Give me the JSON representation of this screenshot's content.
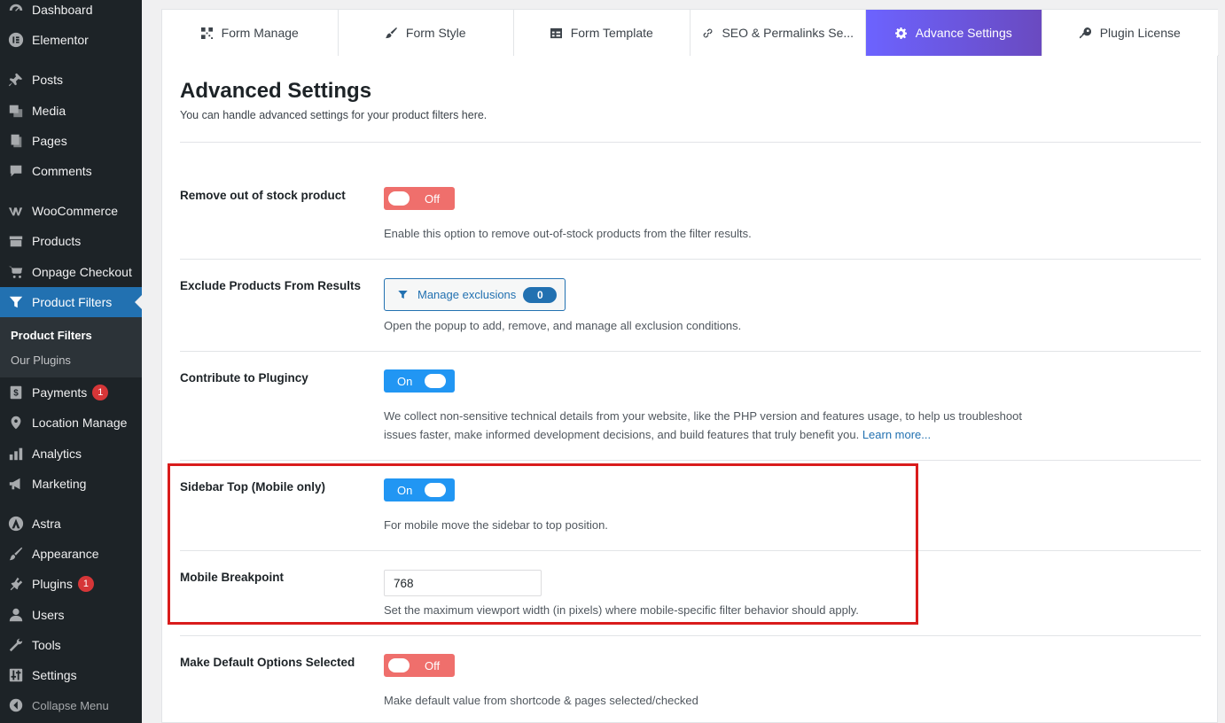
{
  "sidebar": {
    "items": [
      {
        "label": "Dashboard",
        "icon": "dashboard-icon"
      },
      {
        "label": "Elementor",
        "icon": "elementor-icon"
      },
      {
        "label": "Posts",
        "icon": "pin-icon"
      },
      {
        "label": "Media",
        "icon": "media-icon"
      },
      {
        "label": "Pages",
        "icon": "pages-icon"
      },
      {
        "label": "Comments",
        "icon": "comments-icon"
      },
      {
        "label": "WooCommerce",
        "icon": "woocommerce-icon"
      },
      {
        "label": "Products",
        "icon": "products-icon"
      },
      {
        "label": "Onpage Checkout",
        "icon": "cart-icon"
      },
      {
        "label": "Product Filters",
        "icon": "filter-icon"
      },
      {
        "label": "Payments",
        "icon": "payments-icon",
        "badge": "1"
      },
      {
        "label": "Location Manage",
        "icon": "location-icon"
      },
      {
        "label": "Analytics",
        "icon": "analytics-icon"
      },
      {
        "label": "Marketing",
        "icon": "megaphone-icon"
      },
      {
        "label": "Astra",
        "icon": "astra-icon"
      },
      {
        "label": "Appearance",
        "icon": "brush-icon"
      },
      {
        "label": "Plugins",
        "icon": "plugin-icon",
        "badge": "1"
      },
      {
        "label": "Users",
        "icon": "user-icon"
      },
      {
        "label": "Tools",
        "icon": "wrench-icon"
      },
      {
        "label": "Settings",
        "icon": "settings-sliders-icon"
      }
    ],
    "submenu": [
      "Product Filters",
      "Our Plugins"
    ],
    "collapse_label": "Collapse Menu"
  },
  "tabs": [
    {
      "label": "Form Manage",
      "icon": "qr-grid-icon"
    },
    {
      "label": "Form Style",
      "icon": "brush-icon"
    },
    {
      "label": "Form Template",
      "icon": "table-icon"
    },
    {
      "label": "SEO & Permalinks Se...",
      "icon": "link-icon"
    },
    {
      "label": "Advance Settings",
      "icon": "gear-icon"
    },
    {
      "label": "Plugin License",
      "icon": "key-icon"
    }
  ],
  "main": {
    "title": "Advanced Settings",
    "subtitle": "You can handle advanced settings for your product filters here."
  },
  "settings": {
    "remove_oos": {
      "label": "Remove out of stock product",
      "state": "Off",
      "desc": "Enable this option to remove out-of-stock products from the filter results."
    },
    "exclude": {
      "label": "Exclude Products From Results",
      "button": "Manage exclusions",
      "count": "0",
      "desc": "Open the popup to add, remove, and manage all exclusion conditions."
    },
    "contribute": {
      "label": "Contribute to Plugincy",
      "state": "On",
      "desc_line1": "We collect non-sensitive technical details from your website, like the PHP version and features usage, to help us troubleshoot",
      "desc_line2": "issues faster, make informed development decisions, and build features that truly benefit you.",
      "link": "Learn more..."
    },
    "sidebar_top": {
      "label": "Sidebar Top (Mobile only)",
      "state": "On",
      "desc": "For mobile move the sidebar to top position."
    },
    "breakpoint": {
      "label": "Mobile Breakpoint",
      "value": "768",
      "desc": "Set the maximum viewport width (in pixels) where mobile-specific filter behavior should apply."
    },
    "default_selected": {
      "label": "Make Default Options Selected",
      "state": "Off",
      "desc": "Make default value from shortcode & pages selected/checked"
    }
  },
  "colors": {
    "accent": "#2271b1",
    "toggle_on": "#2196f3",
    "toggle_off": "#ef6f6c",
    "highlight": "#d91c1c",
    "active_tab": "#6a5be0"
  }
}
